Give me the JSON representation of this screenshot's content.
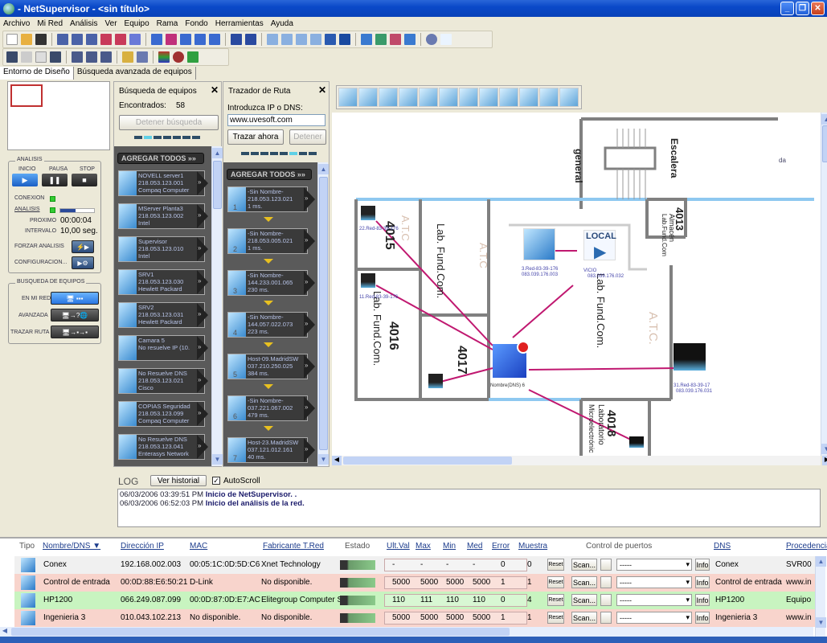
{
  "window": {
    "title": "- NetSupervisor -  <sin título>"
  },
  "menu": [
    "Archivo",
    "Mi Red",
    "Análisis",
    "Ver",
    "Equipo",
    "Rama",
    "Fondo",
    "Herramientas",
    "Ayuda"
  ],
  "tabs": [
    "Entorno de Diseño",
    "Búsqueda avanzada de equipos"
  ],
  "analysis": {
    "title": "ANALISIS",
    "inicio": "INICIO",
    "pausa": "PAUSA",
    "stop": "STOP",
    "conexion": "CONEXION",
    "analisis": "ANALISIS",
    "analysis_progress_pct": 45,
    "proximo_label": "PROXIMO",
    "proximo_value": "00:00:04",
    "intervalo_label": "INTERVALO",
    "intervalo_value": "10,00 seg.",
    "forzar": "FORZAR ANALISIS",
    "config": "CONFIGURACION..."
  },
  "search_group": {
    "title": "BUSQUEDA DE EQUIPOS",
    "en_mi_red": "EN MI RED",
    "avanzada": "AVANZADA",
    "trazar": "TRAZAR RUTA"
  },
  "busqueda": {
    "title": "Búsqueda de equipos",
    "found_label": "Encontrados:",
    "found_value": "58",
    "stop_button": "Detener búsqueda",
    "add_all": "AGREGAR TODOS  »»",
    "devices": [
      {
        "name": "NOVELL server1",
        "ip": "218.053.123.001",
        "vendor": "Compaq Computer"
      },
      {
        "name": "MServer Planta3",
        "ip": "218.053.123.002",
        "vendor": "Intel"
      },
      {
        "name": "Supervisor",
        "ip": "218.053.123.010",
        "vendor": "Intel"
      },
      {
        "name": "SRV1",
        "ip": "218.053.123.030",
        "vendor": "Hewlett Packard"
      },
      {
        "name": "SRV2",
        "ip": "218.053.123.031",
        "vendor": "Hewlett Packard"
      },
      {
        "name": "Camara 5",
        "ip": "No resuelve IP (10.",
        "vendor": ""
      },
      {
        "name": "No Resuelve DNS",
        "ip": "218.053.123.021",
        "vendor": "Cisco"
      },
      {
        "name": "COPIAS Seguridad",
        "ip": "218.053.123.099",
        "vendor": "Compaq Computer"
      },
      {
        "name": "No Resuelve DNS",
        "ip": "218.053.123.041",
        "vendor": "Enterasys Network"
      }
    ]
  },
  "trazador": {
    "title": "Trazador de Ruta",
    "prompt": "Introduzca IP o DNS:",
    "input_value": "www.uvesoft.com",
    "trace_button": "Trazar ahora",
    "stop_button": "Detener",
    "add_all": "AGREGAR TODOS  »»",
    "hops": [
      {
        "n": "1",
        "name": "-Sin Nombre-",
        "ip": "218.053.123.021",
        "ms": "1 ms."
      },
      {
        "n": "2",
        "name": "-Sin Nombre-",
        "ip": "218.053.005.021",
        "ms": "1 ms."
      },
      {
        "n": "3",
        "name": "-Sin Nombre-",
        "ip": "144.233.001.065",
        "ms": "230 ms."
      },
      {
        "n": "4",
        "name": "-Sin Nombre-",
        "ip": "144.057.022.073",
        "ms": "223 ms."
      },
      {
        "n": "5",
        "name": "Host-09.MadridSW",
        "ip": "037.210.250.025",
        "ms": "384 ms."
      },
      {
        "n": "6",
        "name": "-Sin Nombre-",
        "ip": "037.221.067.002",
        "ms": "479 ms."
      },
      {
        "n": "7",
        "name": "Host-23.MadridSW",
        "ip": "037.121.012.161",
        "ms": "40 ms."
      }
    ]
  },
  "map": {
    "labels": {
      "general": "general",
      "escalera": "Escalera",
      "da": "da",
      "r4015": "4015",
      "r4016": "4016",
      "r4017": "4017",
      "r4013": "4013",
      "r4018": "4018",
      "almacen": "Almacén",
      "almacen2": "Lab.Fund.Com",
      "lab1": "Lab. Fund.Com.",
      "lab2": "Lab. Fund.Com.",
      "lab3": "Lab. Fund.Com.",
      "lab4018a": "Laboratorio",
      "lab4018b": "Microelectrónic",
      "atc": "A.T.C",
      "atc2": "A.T.C."
    },
    "nodes": [
      {
        "id": "n22",
        "label": "22.Red-83-39-176"
      },
      {
        "id": "n11",
        "label": "11.Red-83-39-176"
      },
      {
        "id": "n3",
        "label": "3.Red-83-39-176",
        "ip": "083.039.176.003"
      },
      {
        "id": "local",
        "label": "VICIO",
        "ip": "083.039.176.032",
        "badge": "LOCAL"
      },
      {
        "id": "center",
        "label": "Nombre(DNS) 6"
      },
      {
        "id": "n31",
        "label": "31.Red-83-39-17",
        "ip": "083.039.176.031"
      }
    ]
  },
  "log": {
    "title": "LOG",
    "history_button": "Ver historial",
    "autoscroll": "AutoScroll",
    "autoscroll_checked": true,
    "entries": [
      {
        "time": "06/03/2006 03:39:51 PM",
        "msg": "Inicio de NetSupervisor. ."
      },
      {
        "time": "06/03/2006 06:52:03 PM",
        "msg": "Inicio del análisis de la red."
      }
    ]
  },
  "grid": {
    "headers": [
      "Tipo",
      "Nombre/DNS ▼",
      "Dirección IP",
      "MAC",
      "Fabricante T.Red",
      "Estado",
      "Ult.Val",
      "Max",
      "Min",
      "Med",
      "Error",
      "Muestra",
      "Control de puertos",
      "DNS",
      "Procedencia"
    ],
    "reset": "Reset",
    "scan": "Scan...",
    "info": "Info",
    "port_select": "-----",
    "rows": [
      {
        "name": "Conex",
        "ip": "192.168.002.003",
        "mac": "00:05:1C:0D:5D:C6",
        "vendor": "Xnet Technology",
        "ult": "-",
        "max": "-",
        "min": "-",
        "med": "-",
        "err": "0",
        "muestra": "0",
        "dns": "Conex",
        "proc": "SVR00",
        "color": "#f0f0f0"
      },
      {
        "name": "Control de entrada",
        "ip": "00:0D:88:E6:50:21",
        "mac": "D-Link",
        "vendor": "No disponible.",
        "ult": "5000",
        "max": "5000",
        "min": "5000",
        "med": "5000",
        "err": "1",
        "muestra": "1",
        "dns": "Control de entrada",
        "proc": "www.in",
        "color": "#f8d4cc"
      },
      {
        "name": "HP1200",
        "ip": "066.249.087.099",
        "mac": "00:0D:87:0D:E7:AC",
        "vendor": "Elitegroup Computer Sy",
        "ult": "110",
        "max": "111",
        "min": "110",
        "med": "110",
        "err": "0",
        "muestra": "4",
        "dns": "HP1200",
        "proc": "Equipo",
        "color": "#c8f4c0"
      },
      {
        "name": "Ingenieria 3",
        "ip": "010.043.102.213",
        "mac": "No disponible.",
        "vendor": "No disponible.",
        "ult": "5000",
        "max": "5000",
        "min": "5000",
        "med": "5000",
        "err": "1",
        "muestra": "1",
        "dns": "Ingenieria 3",
        "proc": "www.in",
        "color": "#f8d4cc"
      }
    ]
  }
}
